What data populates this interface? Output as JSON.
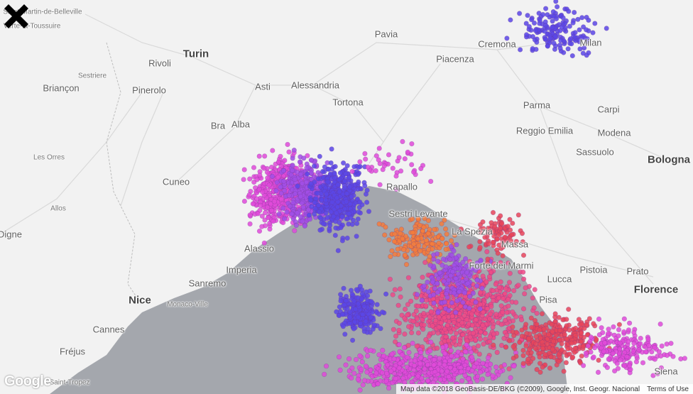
{
  "map": {
    "cities": [
      {
        "name": "Saint-Martin-de-Belleville",
        "size": "small"
      },
      {
        "name": "Verte-la-Toussuire",
        "size": "small"
      },
      {
        "name": "Turin",
        "size": "big"
      },
      {
        "name": "Pavia",
        "size": "med"
      },
      {
        "name": "Cremona",
        "size": "med"
      },
      {
        "name": "Piacenza",
        "size": "med"
      },
      {
        "name": "Rivoli",
        "size": "med"
      },
      {
        "name": "Sestriere",
        "size": "small"
      },
      {
        "name": "Briançon",
        "size": "med"
      },
      {
        "name": "Pinerolo",
        "size": "med"
      },
      {
        "name": "Asti",
        "size": "med"
      },
      {
        "name": "Alessandria",
        "size": "med"
      },
      {
        "name": "Tortona",
        "size": "med"
      },
      {
        "name": "Parma",
        "size": "med"
      },
      {
        "name": "Carpi",
        "size": "med"
      },
      {
        "name": "Reggio Emilia",
        "size": "med"
      },
      {
        "name": "Modena",
        "size": "med"
      },
      {
        "name": "Bra",
        "size": "med"
      },
      {
        "name": "Alba",
        "size": "med"
      },
      {
        "name": "Sassuolo",
        "size": "med"
      },
      {
        "name": "Bologna",
        "size": "big"
      },
      {
        "name": "Les Orres",
        "size": "small"
      },
      {
        "name": "Cuneo",
        "size": "med"
      },
      {
        "name": "Rapallo",
        "size": "med"
      },
      {
        "name": "Sestri Levante",
        "size": "med"
      },
      {
        "name": "Allos",
        "size": "small"
      },
      {
        "name": "La Spezia",
        "size": "med"
      },
      {
        "name": "Massa",
        "size": "med"
      },
      {
        "name": "Alassio",
        "size": "med"
      },
      {
        "name": "Imperia",
        "size": "med"
      },
      {
        "name": "Forte dei Marmi",
        "size": "med"
      },
      {
        "name": "Pistoia",
        "size": "med"
      },
      {
        "name": "Prato",
        "size": "med"
      },
      {
        "name": "Sanremo",
        "size": "med"
      },
      {
        "name": "Lucca",
        "size": "med"
      },
      {
        "name": "Nice",
        "size": "big"
      },
      {
        "name": "Monaco-Ville",
        "size": "small"
      },
      {
        "name": "Florence",
        "size": "big"
      },
      {
        "name": "Pisa",
        "size": "med"
      },
      {
        "name": "Cannes",
        "size": "med"
      },
      {
        "name": "Fréjus",
        "size": "med"
      },
      {
        "name": "Saint-Tropez",
        "size": "small"
      },
      {
        "name": "Digne",
        "size": "med"
      },
      {
        "name": "Siena",
        "size": "med"
      },
      {
        "name": "Milan",
        "size": "med"
      }
    ],
    "marker_icon": "x-marker-icon",
    "cluster_colors": {
      "blue": "#5a46e6",
      "violet": "#a14fe6",
      "magenta": "#e04ad9",
      "pink": "#ee4a86",
      "orange": "#f47c3c",
      "red": "#e8455a"
    },
    "sea_color": "#a4a7ad",
    "land_color": "#f2f2f2"
  },
  "footer": {
    "logo": "Google",
    "attribution": "Map data ©2018 GeoBasis-DE/BKG (©2009), Google, Inst. Geogr. Nacional",
    "terms": "Terms of Use"
  }
}
